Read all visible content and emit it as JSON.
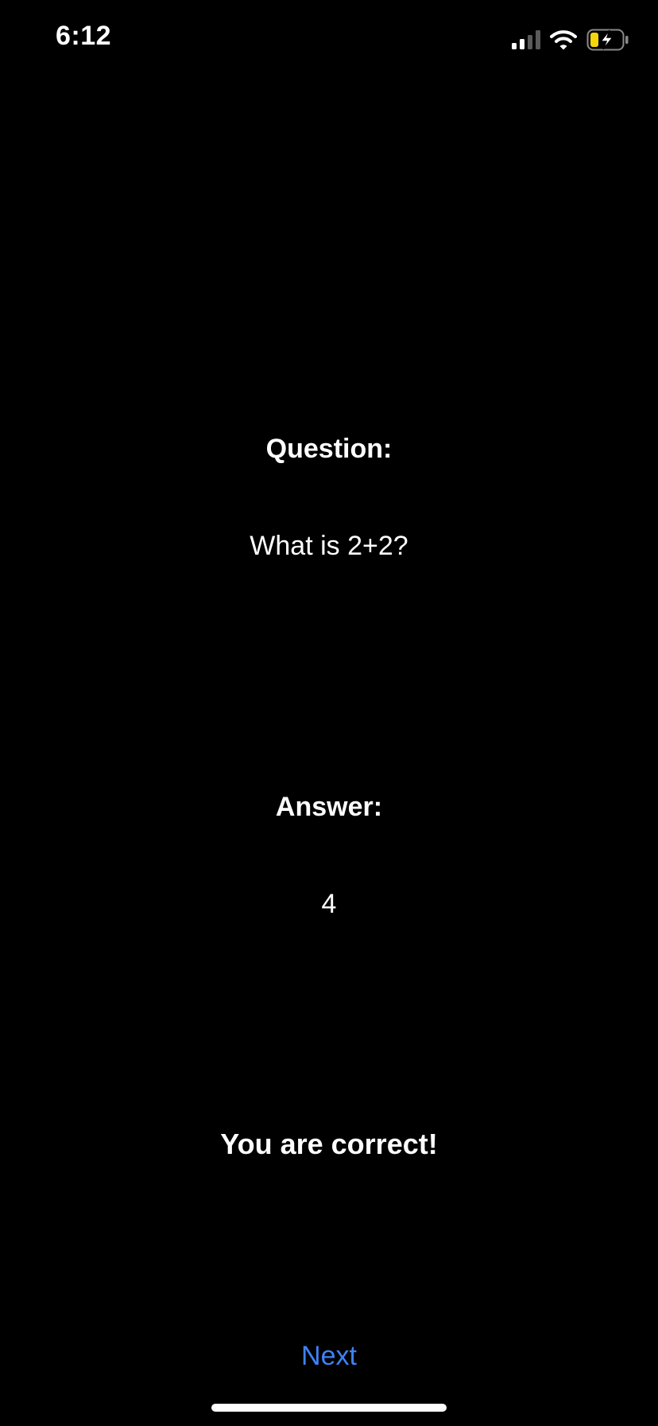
{
  "status_bar": {
    "time": "6:12",
    "icons": [
      "cellular-signal-icon",
      "wifi-icon",
      "battery-charging-icon"
    ],
    "battery_color": "#f5d60a"
  },
  "quiz": {
    "question_label": "Question:",
    "question_text": "What is 2+2?",
    "answer_label": "Answer:",
    "answer_text": "4",
    "feedback": "You are correct!"
  },
  "actions": {
    "next_label": "Next"
  },
  "colors": {
    "background": "#000000",
    "text": "#ffffff",
    "accent": "#3e82f7"
  }
}
